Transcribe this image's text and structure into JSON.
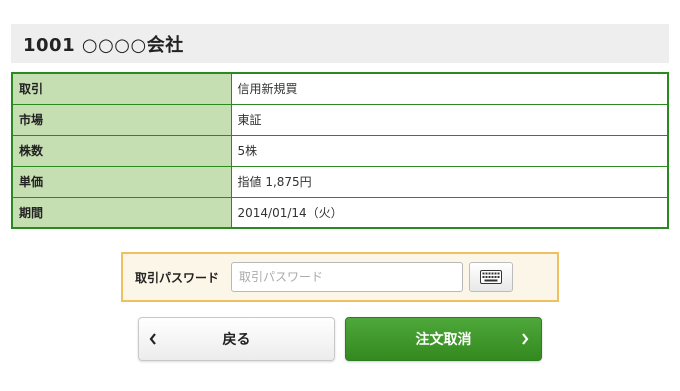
{
  "header": {
    "title": "1001 ○○○○会社"
  },
  "order_details": {
    "rows": [
      {
        "label": "取引",
        "value": "信用新規買"
      },
      {
        "label": "市場",
        "value": "東証"
      },
      {
        "label": "株数",
        "value": "5株"
      },
      {
        "label": "単価",
        "value": "指値 1,875円"
      },
      {
        "label": "期間",
        "value": "2014/01/14（火）"
      }
    ]
  },
  "password": {
    "label": "取引パスワード",
    "value": "",
    "placeholder": "取引パスワード",
    "keyboard_icon": "keyboard-icon"
  },
  "buttons": {
    "back_label": "戻る",
    "cancel_label": "注文取消",
    "back_icon": "chevron-left-icon",
    "cancel_icon": "chevron-right-icon"
  },
  "colors": {
    "table_border": "#2a8a1f",
    "label_bg": "#c5dfb3",
    "password_box_border": "#f0c060",
    "password_box_bg": "#fcf6e8",
    "cancel_button": "#3f9a2c",
    "header_bg": "#eeeeee"
  }
}
